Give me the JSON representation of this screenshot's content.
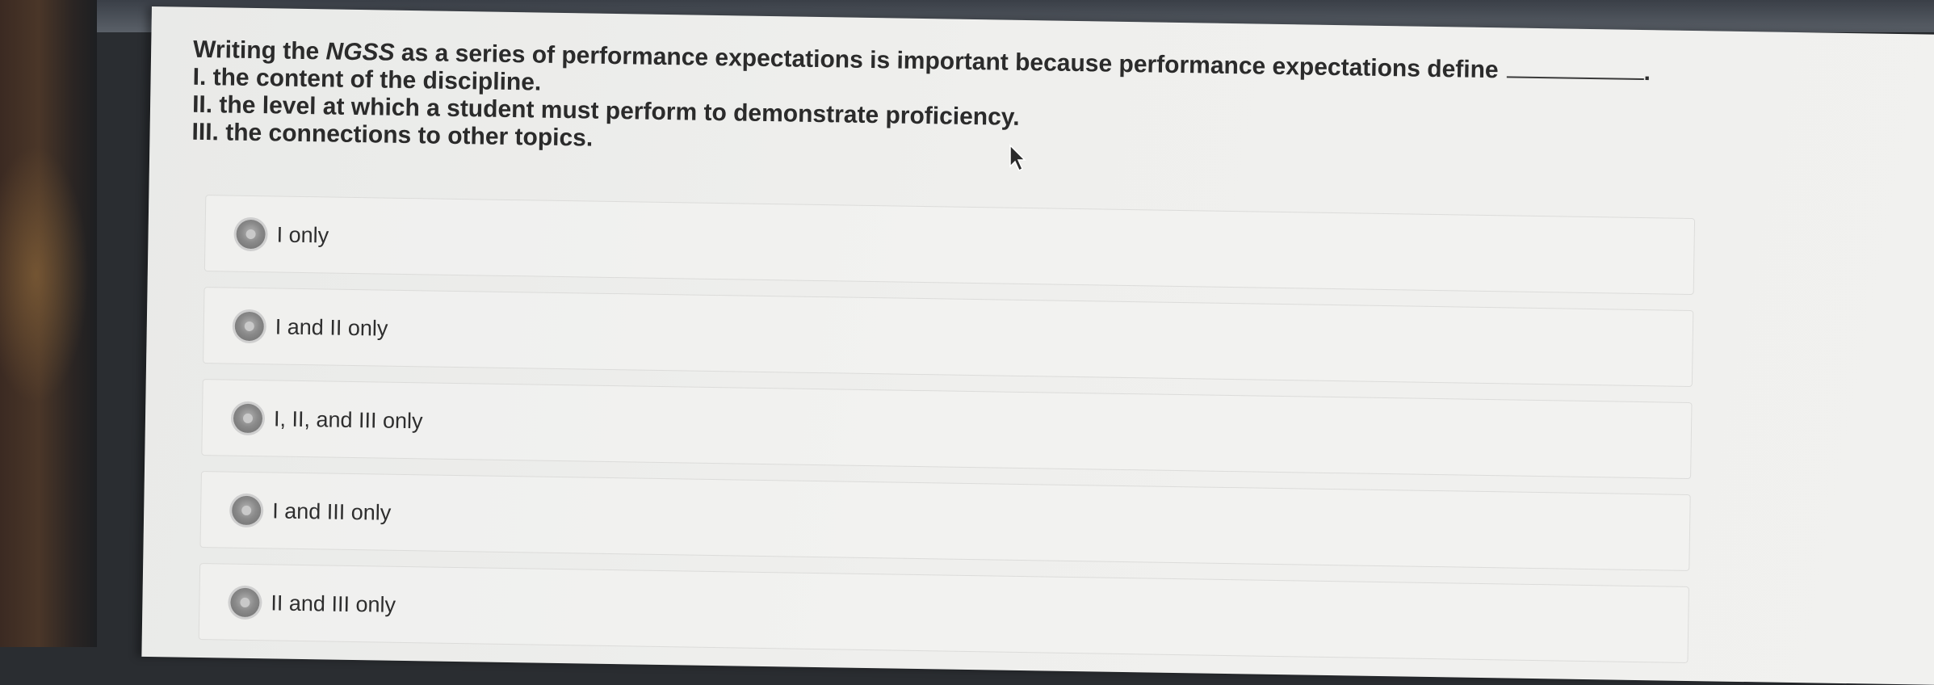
{
  "question": {
    "prefix": "Writing the",
    "emphasis": "NGSS",
    "suffix": "as a series of performance expectations is important because performance expectations define",
    "blank_period": ".",
    "items": [
      "I. the content of the discipline.",
      "II. the level at which a student must perform to demonstrate proficiency.",
      "III. the connections to other topics."
    ]
  },
  "options": [
    {
      "label": "I only"
    },
    {
      "label": "I and II only"
    },
    {
      "label": "I, II, and III only"
    },
    {
      "label": "I and III only"
    },
    {
      "label": "II and III only"
    }
  ],
  "icons": {
    "radio": "radio-button-icon",
    "cursor": "mouse-pointer-icon"
  }
}
